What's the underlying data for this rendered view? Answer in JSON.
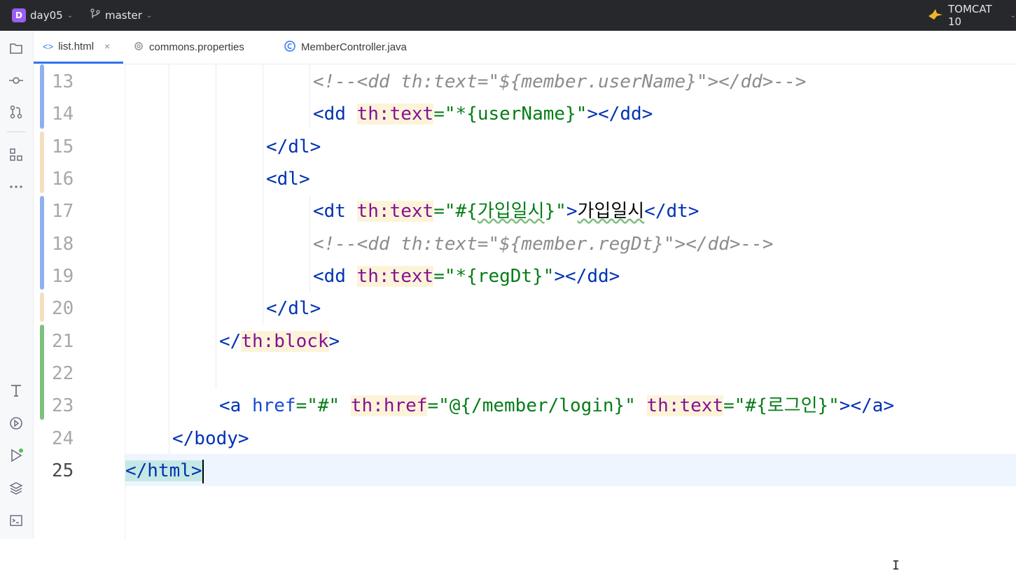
{
  "titlebar": {
    "project_badge": "D",
    "project_name": "day05",
    "branch_name": "master",
    "run_config": "TOMCAT 10"
  },
  "tabs": [
    {
      "label": "list.html",
      "icon": "html-tag-icon",
      "active": true,
      "close": "×"
    },
    {
      "label": "commons.properties",
      "icon": "gear-icon",
      "active": false
    },
    {
      "label": "MemberController.java",
      "icon": "class-icon",
      "active": false
    }
  ],
  "toolstrip": [
    "project-icon",
    "commit-icon",
    "pull-requests-icon",
    "structure-icon",
    "more-icon",
    "text-icon",
    "services-icon",
    "run-icon",
    "layers-icon",
    "terminal-icon"
  ],
  "colors": {
    "accent": "#3574f0",
    "change_modified": "#8fb0f0",
    "change_added": "#7ec07e",
    "change_other": "#f2dfc0",
    "tag": "#0033b3",
    "attribute_thymeleaf": "#871094",
    "string": "#067d17",
    "comment": "#8c8c8c"
  },
  "editor": {
    "line_numbers": [
      "13",
      "14",
      "15",
      "16",
      "17",
      "18",
      "19",
      "20",
      "21",
      "22",
      "23",
      "24",
      "25"
    ],
    "current_line": "25",
    "lines": [
      {
        "number": "13",
        "text": "<!--<dd th:text=\"${member.userName}\"></dd>-->"
      },
      {
        "number": "14",
        "text": "<dd th:text=\"*{userName}\"></dd>"
      },
      {
        "number": "15",
        "text": "</dl>"
      },
      {
        "number": "16",
        "text": "<dl>"
      },
      {
        "number": "17",
        "text": "<dt th:text=\"#{가입일시}\">가입일시</dt>"
      },
      {
        "number": "18",
        "text": "<!--<dd th:text=\"${member.regDt}\"></dd>-->"
      },
      {
        "number": "19",
        "text": "<dd th:text=\"*{regDt}\"></dd>"
      },
      {
        "number": "20",
        "text": "</dl>"
      },
      {
        "number": "21",
        "text": "</th:block>"
      },
      {
        "number": "22",
        "text": ""
      },
      {
        "number": "23",
        "text": "<a href=\"#\" th:href=\"@{/member/login}\" th:text=\"#{로그인}\"></a>"
      },
      {
        "number": "24",
        "text": "</body>"
      },
      {
        "number": "25",
        "text": "</html>"
      }
    ]
  }
}
